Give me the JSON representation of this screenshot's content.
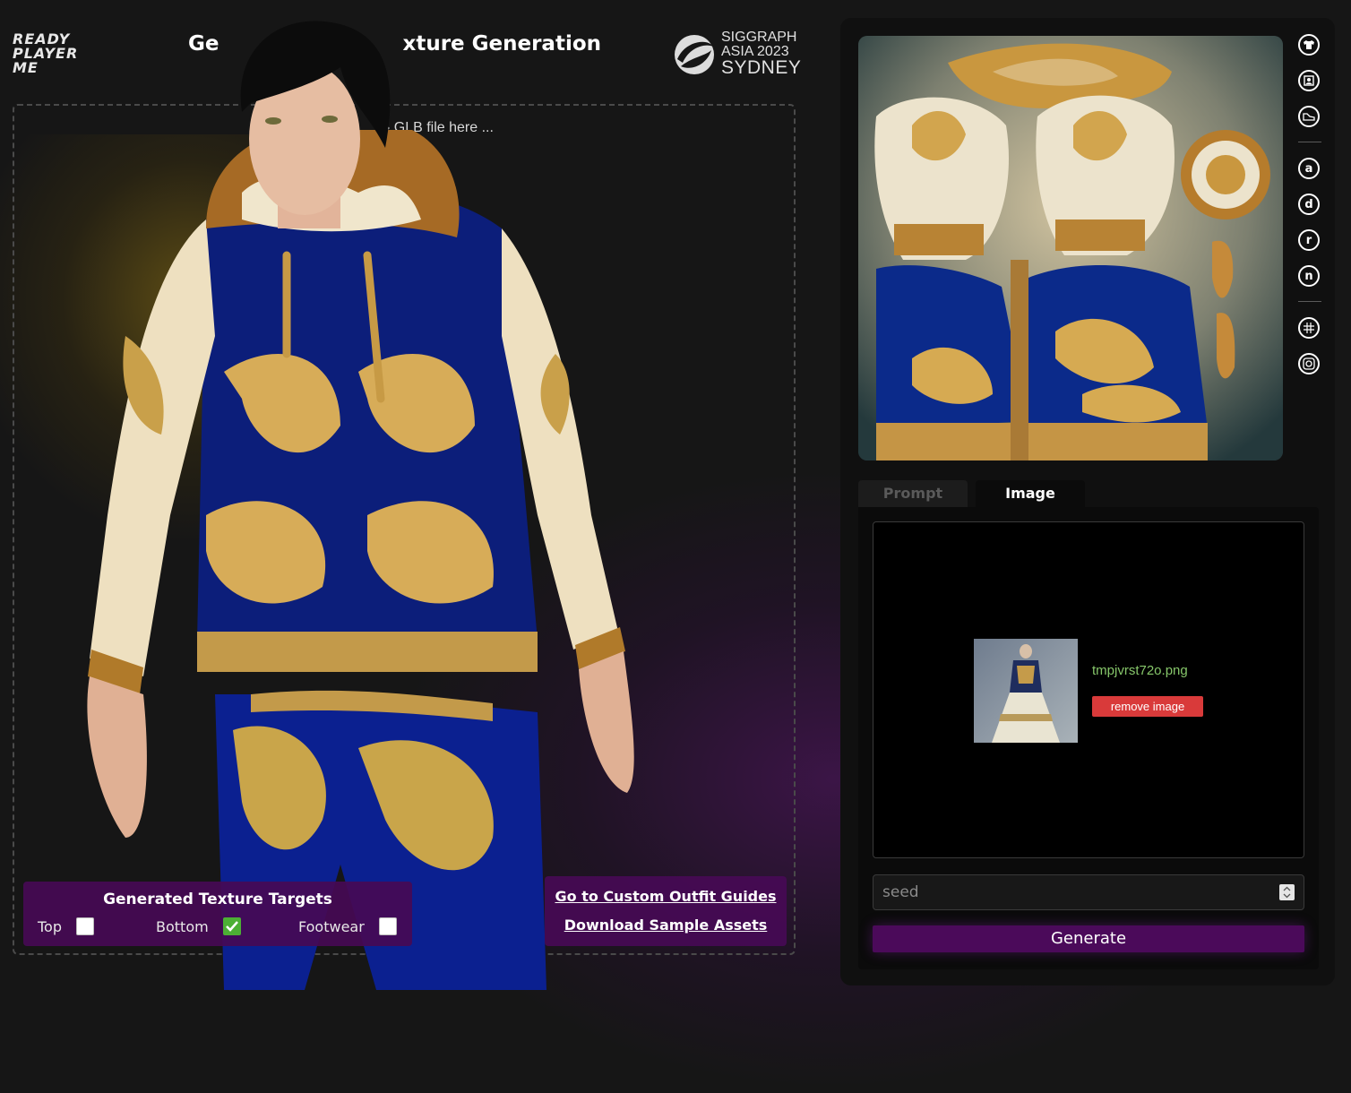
{
  "header": {
    "brand_lines": [
      "READY",
      "PLAYER",
      "ME"
    ],
    "title_left": "Ge",
    "title_right": "xture Generation",
    "event": {
      "line1": "SIGGRAPH",
      "line2": "ASIA 2023",
      "line3": "SYDNEY"
    }
  },
  "viewer": {
    "drop_hint": "› GLB file here ..."
  },
  "targets": {
    "title": "Generated Texture Targets",
    "items": [
      {
        "label": "Top",
        "checked": false
      },
      {
        "label": "Bottom",
        "checked": true
      },
      {
        "label": "Footwear",
        "checked": false
      }
    ]
  },
  "links": {
    "guides": "Go to Custom Outfit Guides",
    "samples": "Download Sample Assets"
  },
  "sidebar": {
    "icons": [
      "shirt-icon",
      "portrait-icon",
      "shoe-icon",
      "a",
      "d",
      "r",
      "n",
      "globe-icon",
      "camera-icon"
    ]
  },
  "tabs": [
    {
      "label": "Prompt",
      "active": false
    },
    {
      "label": "Image",
      "active": true
    }
  ],
  "image_upload": {
    "filename": "tmpjvrst72o.png",
    "remove_label": "remove image"
  },
  "seed": {
    "placeholder": "seed"
  },
  "generate_label": "Generate",
  "colors": {
    "accent_purple": "#4b0a5a",
    "checkbox_green": "#4caf35",
    "remove_red": "#d93a3a",
    "filename_green": "#86c66a"
  }
}
